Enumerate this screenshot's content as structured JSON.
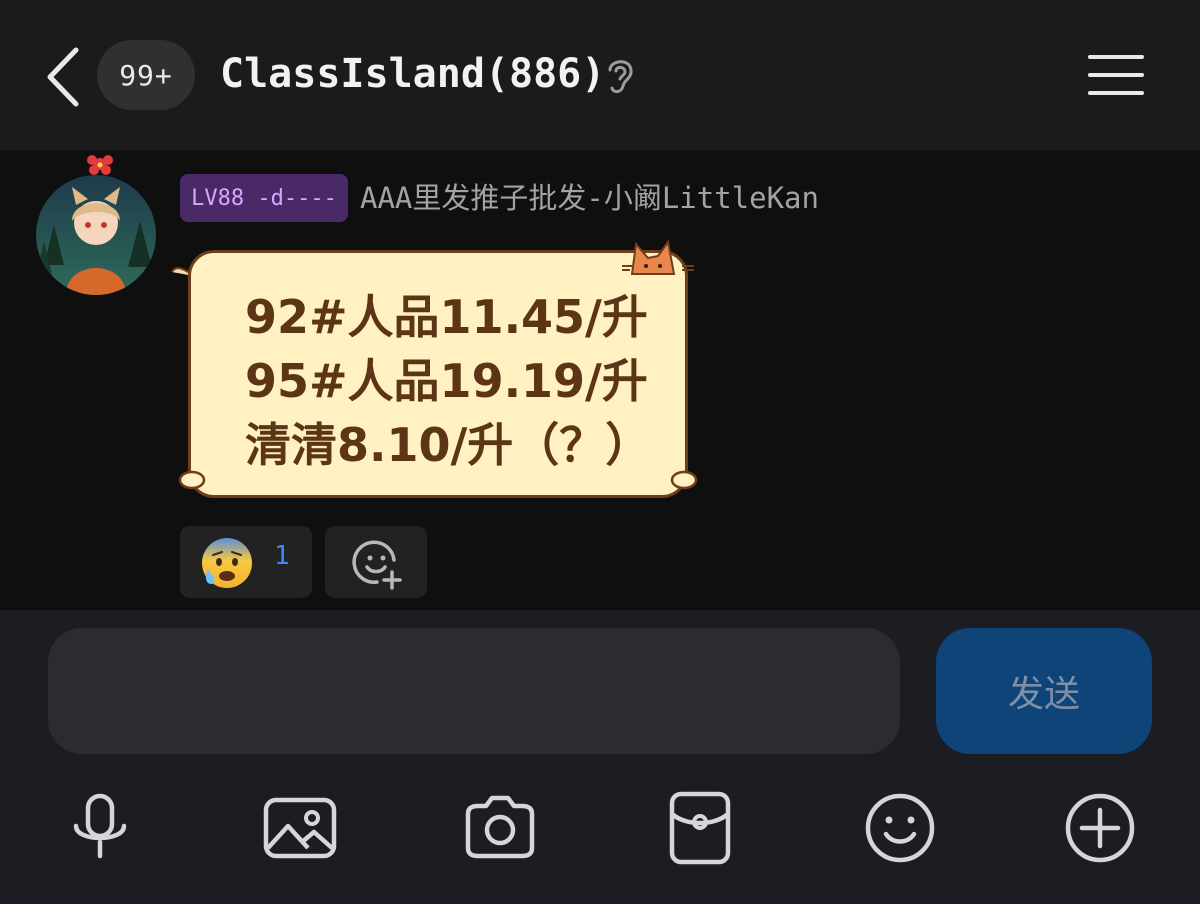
{
  "header": {
    "unread_count": "99+",
    "title": "ClassIsland(886)"
  },
  "message": {
    "level_badge": "LV88 -d----",
    "sender": "AAA里发推子批发-小阚LittleKan",
    "lines": [
      "92#人品11.45/升",
      "95#人品19.19/升",
      "清清8.10/升（？）"
    ],
    "reaction": {
      "emoji": "anxious-face-with-sweat",
      "count": "1"
    }
  },
  "composer": {
    "input_value": "",
    "send_label": "发送"
  },
  "toolbar": {
    "icons": [
      "microphone-icon",
      "image-icon",
      "camera-icon",
      "red-packet-icon",
      "emoji-icon",
      "plus-icon"
    ]
  },
  "colors": {
    "header_bg": "#1b1b1c",
    "bubble_bg": "#fff1c1",
    "bubble_text": "#5c3516",
    "send_button": "#0f4479",
    "badge_bg": "#4a2a66"
  }
}
